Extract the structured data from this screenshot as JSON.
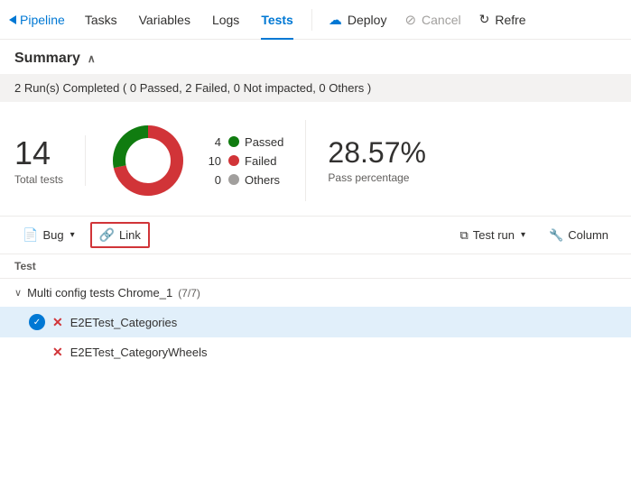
{
  "nav": {
    "back_label": "Pipeline",
    "items": [
      {
        "label": "Tasks",
        "active": false
      },
      {
        "label": "Variables",
        "active": false
      },
      {
        "label": "Logs",
        "active": false
      },
      {
        "label": "Tests",
        "active": true
      }
    ],
    "actions": [
      {
        "label": "Deploy",
        "icon": "cloud-icon",
        "disabled": false
      },
      {
        "label": "Cancel",
        "icon": "cancel-icon",
        "disabled": true
      },
      {
        "label": "Refre",
        "icon": "refresh-icon",
        "disabled": false
      }
    ]
  },
  "summary": {
    "title": "Summary",
    "status_bar": "2 Run(s) Completed ( 0 Passed, 2 Failed, 0 Not impacted, 0 Others )",
    "total_tests": "14",
    "total_label": "Total tests",
    "legend": [
      {
        "count": "4",
        "label": "Passed",
        "color": "#107c10"
      },
      {
        "count": "10",
        "label": "Failed",
        "color": "#d13438"
      },
      {
        "count": "0",
        "label": "Others",
        "color": "#a19f9d"
      }
    ],
    "pass_percentage": "28.57%",
    "pass_label": "Pass percentage",
    "donut": {
      "passed_deg": 102,
      "failed_deg": 258,
      "others_deg": 0
    }
  },
  "toolbar": {
    "bug_label": "Bug",
    "link_label": "Link",
    "test_run_label": "Test run",
    "column_label": "Column"
  },
  "table": {
    "header": "Test",
    "groups": [
      {
        "label": "Multi config tests Chrome_1",
        "badge": "(7/7)",
        "items": [
          {
            "name": "E2ETest_Categories",
            "status": "failed",
            "selected": true
          },
          {
            "name": "E2ETest_CategoryWheels",
            "status": "failed",
            "selected": false
          }
        ]
      }
    ]
  }
}
